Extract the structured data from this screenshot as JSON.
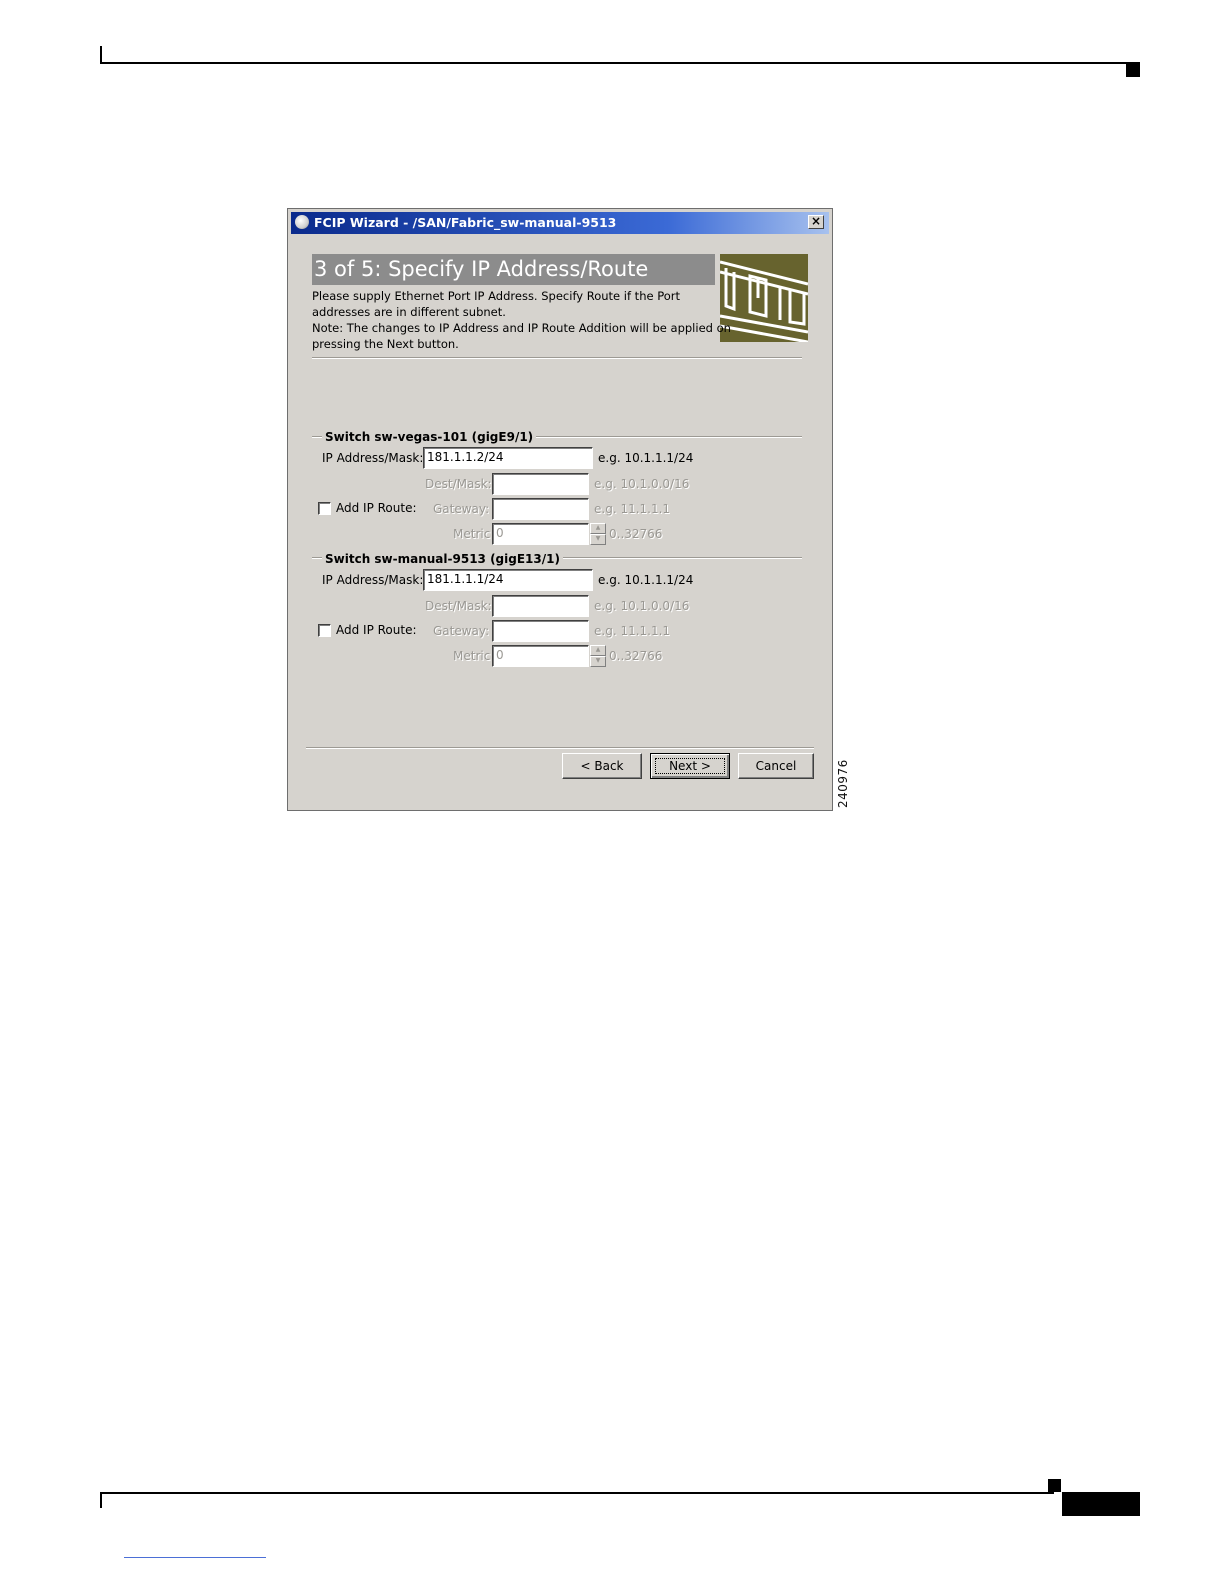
{
  "figure_id": "240976",
  "window": {
    "title": "FCIP Wizard - /SAN/Fabric_sw-manual-9513",
    "close_label": "×"
  },
  "step": {
    "title": "3 of 5: Specify IP Address/Route",
    "instructions": [
      "Please supply Ethernet Port IP Address.  Specify Route if the Port",
      "addresses are in different subnet.",
      "Note: The changes to IP Address and IP Route Addition will be applied on",
      "pressing the Next button."
    ]
  },
  "switches": [
    {
      "title": "Switch sw-vegas-101 (gigE9/1)",
      "ip_label": "IP Address/Mask:",
      "ip_value": "181.1.1.2/24",
      "ip_hint": "e.g. 10.1.1.1/24",
      "route_label": "Add IP Route:",
      "route_checked": false,
      "dest_label": "Dest/Mask:",
      "dest_value": "",
      "dest_hint": "e.g. 10.1.0.0/16",
      "gateway_label": "Gateway:",
      "gateway_value": "",
      "gateway_hint": "e.g. 11.1.1.1",
      "metric_label": "Metric",
      "metric_value": "0",
      "metric_hint": "0..32766"
    },
    {
      "title": "Switch sw-manual-9513 (gigE13/1)",
      "ip_label": "IP Address/Mask:",
      "ip_value": "181.1.1.1/24",
      "ip_hint": "e.g. 10.1.1.1/24",
      "route_label": "Add IP Route:",
      "route_checked": false,
      "dest_label": "Dest/Mask:",
      "dest_value": "",
      "dest_hint": "e.g. 10.1.0.0/16",
      "gateway_label": "Gateway:",
      "gateway_value": "",
      "gateway_hint": "e.g. 11.1.1.1",
      "metric_label": "Metric",
      "metric_value": "0",
      "metric_hint": "0..32766"
    }
  ],
  "buttons": {
    "back": "Back",
    "next": "Next",
    "cancel": "Cancel"
  },
  "colors": {
    "dialog_bg": "#d6d3ce",
    "titlebar": "#0a2a8c",
    "step_banner": "#8c8c8c",
    "graphic": "#67632e"
  }
}
